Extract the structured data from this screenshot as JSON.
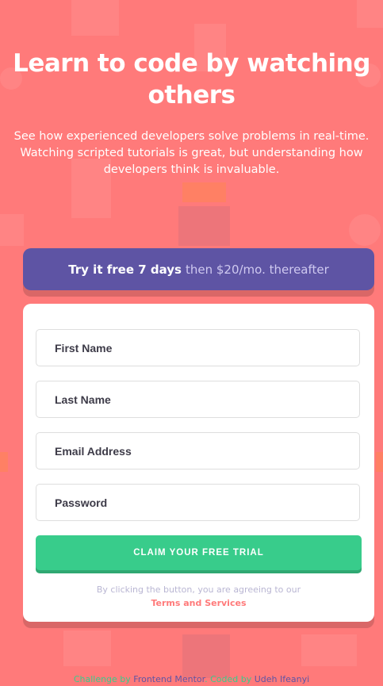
{
  "hero": {
    "title": "Learn to code by watching others",
    "description": "See how experienced developers solve problems in real-time. Watching scripted tutorials is great, but understanding how developers think is invaluable."
  },
  "banner": {
    "bold_text": "Try it free 7 days",
    "sub_text": "then $20/mo. thereafter"
  },
  "form": {
    "first_name": {
      "placeholder": "First Name",
      "value": ""
    },
    "last_name": {
      "placeholder": "Last Name",
      "value": ""
    },
    "email": {
      "placeholder": "Email Address",
      "value": ""
    },
    "password": {
      "placeholder": "Password",
      "value": ""
    },
    "submit_label": "CLAIM YOUR FREE TRIAL",
    "terms_text": "By clicking the button, you are agreeing to our",
    "terms_link": "Terms and Services"
  },
  "footer": {
    "challenge_by": "Challenge by",
    "frontend_mentor": "Frontend Mentor",
    "coded_by": ". Coded by",
    "author": "Udeh Ifeanyi"
  },
  "colors": {
    "background": "#ff7a7a",
    "banner": "#5e54a4",
    "button": "#38cc8b",
    "text_dark": "#3d3b48"
  }
}
